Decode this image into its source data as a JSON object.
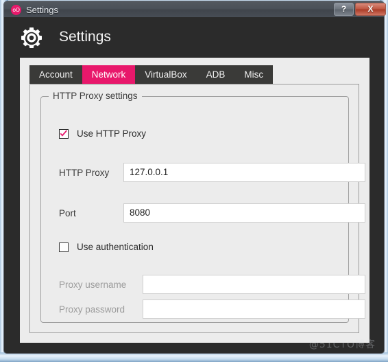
{
  "window": {
    "title": "Settings",
    "app_icon": "genymotion-logo-icon",
    "icon_text": "oO",
    "controls": [
      {
        "name": "help-button",
        "label": "?"
      },
      {
        "name": "close-button",
        "label": "X"
      }
    ]
  },
  "header": {
    "icon": "gear-icon",
    "title": "Settings"
  },
  "tabs": [
    {
      "label": "Account",
      "active": false
    },
    {
      "label": "Network",
      "active": true
    },
    {
      "label": "VirtualBox",
      "active": false
    },
    {
      "label": "ADB",
      "active": false
    },
    {
      "label": "Misc",
      "active": false
    }
  ],
  "groupbox": {
    "title": "HTTP Proxy settings"
  },
  "form": {
    "use_proxy": {
      "label": "Use HTTP Proxy",
      "checked": true
    },
    "http_proxy": {
      "label": "HTTP Proxy",
      "value": "127.0.0.1",
      "placeholder": ""
    },
    "port": {
      "label": "Port",
      "value": "8080",
      "placeholder": ""
    },
    "use_authentication": {
      "label": "Use authentication",
      "checked": false
    },
    "proxy_username": {
      "label": "Proxy username",
      "value": "",
      "placeholder": "",
      "disabled": true
    },
    "proxy_password": {
      "label": "Proxy password",
      "value": "",
      "placeholder": "",
      "disabled": true
    }
  },
  "watermark": {
    "text": "@51CTO博客"
  },
  "colors": {
    "accent": "#e8186b",
    "app_dark": "#2b2b2b",
    "tabbar_dark": "#3a3a38",
    "panel": "#ececec",
    "close_red": "#bf5641"
  }
}
